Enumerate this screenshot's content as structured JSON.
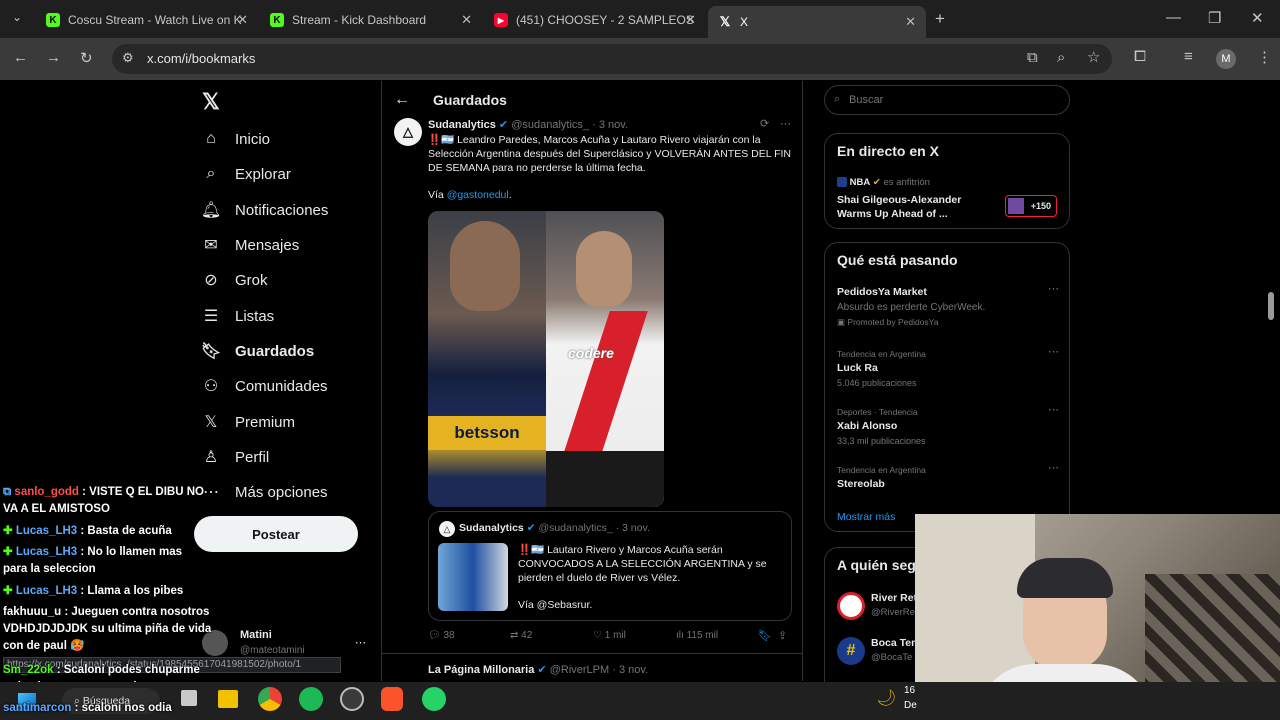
{
  "browser": {
    "tabs": [
      {
        "title": "Coscu Stream - Watch Live on K",
        "favicon_color": "#53fc18"
      },
      {
        "title": "Stream - Kick Dashboard",
        "favicon_color": "#53fc18"
      },
      {
        "title": "(451) CHOOSEY - 2 SAMPLEOS",
        "favicon_color": "#ff0033"
      },
      {
        "title": "X",
        "favicon_color": "#000000"
      }
    ],
    "url": "x.com/i/bookmarks",
    "profile_initial": "M"
  },
  "nav": {
    "items": [
      {
        "label": "Inicio",
        "icon": "home-icon"
      },
      {
        "label": "Explorar",
        "icon": "search-icon"
      },
      {
        "label": "Notificaciones",
        "icon": "bell-icon"
      },
      {
        "label": "Mensajes",
        "icon": "mail-icon"
      },
      {
        "label": "Grok",
        "icon": "grok-icon"
      },
      {
        "label": "Listas",
        "icon": "list-icon"
      },
      {
        "label": "Guardados",
        "icon": "bookmark-icon"
      },
      {
        "label": "Comunidades",
        "icon": "communities-icon"
      },
      {
        "label": "Premium",
        "icon": "x-icon"
      },
      {
        "label": "Perfil",
        "icon": "person-icon"
      },
      {
        "label": "Más opciones",
        "icon": "more-icon"
      }
    ],
    "post_button": "Postear",
    "account": {
      "name": "Matini",
      "handle": "@mateotamini"
    }
  },
  "header": {
    "title": "Guardados"
  },
  "tweet": {
    "author": "Sudanalytics",
    "handle": "@sudanalytics_",
    "date": "· 3 nov.",
    "text": "‼️🇦🇷 Leandro Paredes, Marcos Acuña y Lautaro Rivero viajarán con la Selección Argentina después del Superclásico y VOLVERÁN ANTES DEL FIN DE SEMANA para no perderse la última fecha.",
    "via_prefix": "Vía ",
    "via_link": "@gastonedul",
    "via_suffix": ".",
    "image_text_left": "betsson",
    "image_text_right": "codere",
    "quote": {
      "author": "Sudanalytics",
      "handle": "@sudanalytics_",
      "date": "· 3 nov.",
      "text": "‼️🇦🇷 Lautaro Rivero y Marcos Acuña serán CONVOCADOS A LA SELECCIÓN ARGENTINA y se pierden el duelo de River vs Vélez.",
      "via": "Vía @Sebasrur."
    },
    "stats": {
      "replies": "38",
      "retweets": "42",
      "likes": "1 mil",
      "views": "115 mil"
    }
  },
  "next_tweet": {
    "author": "La Página Millonaria",
    "handle": "@RiverLPM",
    "date": "· 3 nov."
  },
  "status_url": "https://x.com/sudanalytics_/status/1985455617041981502/photo/1",
  "sidebar": {
    "search_placeholder": "Buscar",
    "live": {
      "title": "En directo en X",
      "host": "NBA",
      "host_suffix": "es anfitrión",
      "event": "Shai Gilgeous-Alexander Warms Up Ahead of ...",
      "listeners": "+150"
    },
    "trends_title": "Qué está pasando",
    "trends": [
      {
        "context": "",
        "name": "PedidosYa Market",
        "sub": "Absurdo es perderte CyberWeek.",
        "extra": "Promoted by PedidosYa"
      },
      {
        "context": "Tendencia en Argentina",
        "name": "Luck Ra",
        "sub": "5.046 publicaciones",
        "extra": ""
      },
      {
        "context": "Deportes · Tendencia",
        "name": "Xabi Alonso",
        "sub": "33,3 mil publicaciones",
        "extra": ""
      },
      {
        "context": "Tendencia en Argentina",
        "name": "Stereolab",
        "sub": "",
        "extra": ""
      }
    ],
    "show_more": "Mostrar más",
    "follow_title": "A quién seg",
    "follow": [
      {
        "name": "River Ret",
        "handle": "@RiverRe"
      },
      {
        "name": "Boca Ten",
        "handle": "@BocaTe"
      }
    ]
  },
  "chat": [
    {
      "user": "sanlo_godd",
      "color": "#ff4d4d",
      "msg": " : VISTE Q EL DIBU NO VA A EL AMISTOSO"
    },
    {
      "user": "Lucas_LH3",
      "color": "#5aa9ff",
      "msg": " : Basta de acuña"
    },
    {
      "user": "Lucas_LH3",
      "color": "#5aa9ff",
      "msg": " : No lo llamen mas para la seleccion"
    },
    {
      "user": "Lucas_LH3",
      "color": "#5aa9ff",
      "msg": " : Llama a los pibes"
    },
    {
      "user": "fakhuuu_u",
      "color": "#ffffff",
      "msg": " : Jueguen contra nosotros VDHDJDJDJDK su ultima piña de vida con de paul 🥵"
    },
    {
      "user": "Sm_22ok",
      "color": "#53fc18",
      "msg": " : Scaloni podes chuparme todo el orto y comerme la caca"
    },
    {
      "user": "santimarcon",
      "color": "#5aa9ff",
      "msg": " : scaloni nos odia"
    }
  ],
  "taskbar": {
    "search": "Búsqueda",
    "time": "16",
    "date": "De"
  }
}
